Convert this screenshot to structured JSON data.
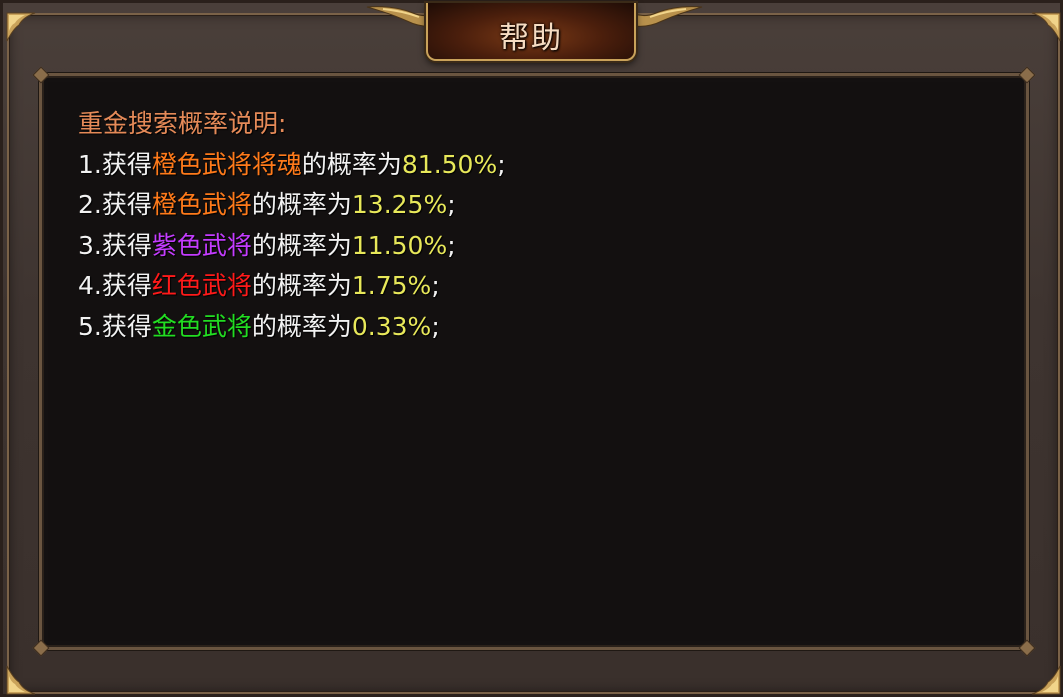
{
  "dialog": {
    "title": "帮助",
    "heading": "重金搜索概率说明:",
    "lines": [
      {
        "prefix": "1.获得",
        "item": "橙色武将将魂",
        "item_color": "#ff7a1a",
        "mid": "的概率为",
        "rate": "81.50%",
        "suffix": ";"
      },
      {
        "prefix": "2.获得",
        "item": "橙色武将",
        "item_color": "#ff7a1a",
        "mid": "的概率为",
        "rate": "13.25%",
        "suffix": ";"
      },
      {
        "prefix": "3.获得",
        "item": "紫色武将",
        "item_color": "#c43cff",
        "mid": "的概率为",
        "rate": "11.50%",
        "suffix": ";"
      },
      {
        "prefix": "4.获得",
        "item": "红色武将",
        "item_color": "#ff1a1a",
        "mid": "的概率为",
        "rate": "1.75%",
        "suffix": ";"
      },
      {
        "prefix": "5.获得",
        "item": "金色武将",
        "item_color": "#22dd22",
        "mid": "的概率为",
        "rate": "0.33%",
        "suffix": ";"
      }
    ]
  },
  "colors": {
    "heading": "#e58a58",
    "rate": "#e8e85a",
    "frame_gold": "#c9a25a",
    "background": "#131010"
  }
}
